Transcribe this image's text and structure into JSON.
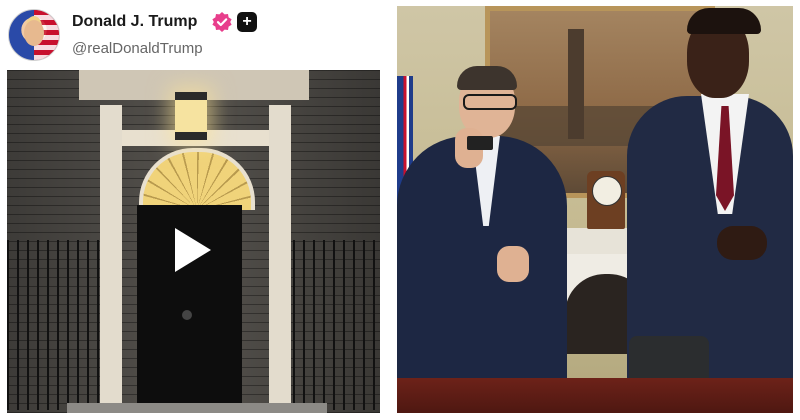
{
  "post": {
    "display_name": "Donald J. Trump",
    "handle": "@realDonaldTrump",
    "verified_icon": "verified-badge-icon",
    "follow_icon": "plus-icon",
    "follow_symbol": "+",
    "play_icon": "play-icon"
  },
  "colors": {
    "verified_badge": "#e83e8c",
    "follow_button": "#111111"
  }
}
